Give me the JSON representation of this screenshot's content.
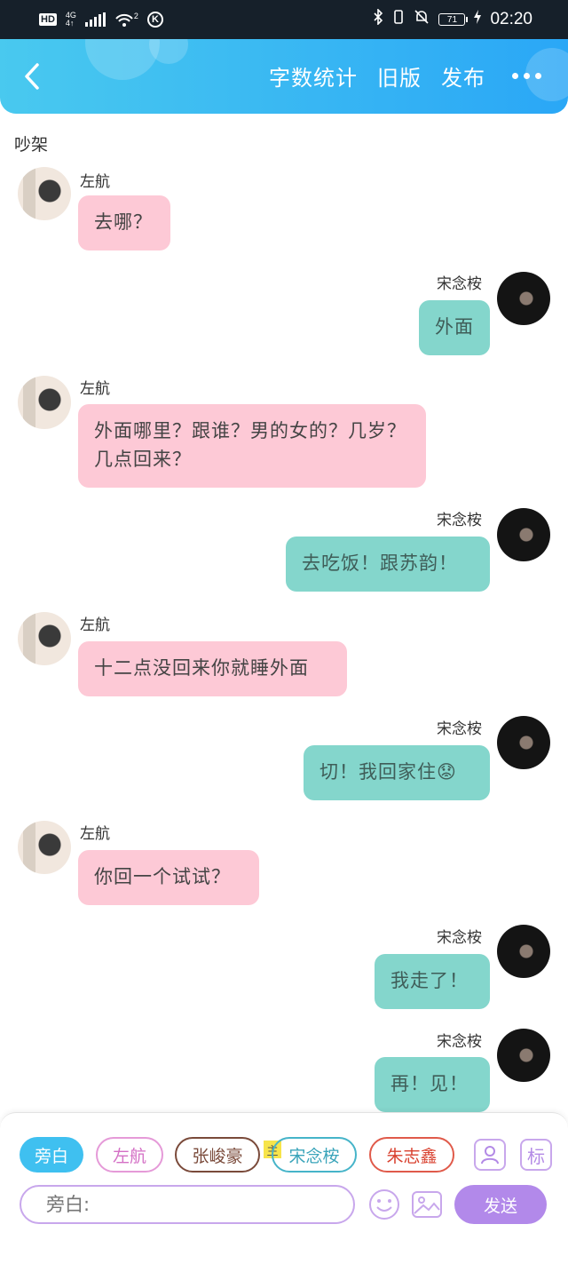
{
  "status_bar": {
    "left_badge": "HD",
    "network_top": "4G",
    "network_bottom": "4↑",
    "wifi_sub": "2",
    "k_label": "K",
    "battery": "71",
    "time": "02:20"
  },
  "header": {
    "actions": [
      "字数统计",
      "旧版",
      "发布"
    ]
  },
  "story_title": "吵架",
  "messages": [
    {
      "side": "left",
      "name": "左航",
      "text": "去哪？"
    },
    {
      "side": "right",
      "name": "宋念桉",
      "text": "外面"
    },
    {
      "side": "left",
      "name": "左航",
      "text": "外面哪里？跟谁？男的女的？几岁？几点回来？"
    },
    {
      "side": "right",
      "name": "宋念桉",
      "text": "去吃饭！跟苏韵！"
    },
    {
      "side": "left",
      "name": "左航",
      "text": "十二点没回来你就睡外面"
    },
    {
      "side": "right",
      "name": "宋念桉",
      "text": "切！我回家住😟"
    },
    {
      "side": "left",
      "name": "左航",
      "text": "你回一个试试？"
    },
    {
      "side": "right",
      "name": "宋念桉",
      "text": "我走了！"
    },
    {
      "side": "right",
      "name": "宋念桉",
      "text": "再！见！"
    }
  ],
  "bottom": {
    "roles": [
      "旁白",
      "左航",
      "张峻豪",
      "宋念桉",
      "朱志鑫"
    ],
    "main_tag": "主",
    "mark_icon_label": "标",
    "input_placeholder": "旁白:",
    "send_label": "发送"
  },
  "colors": {
    "header_start": "#49c9ef",
    "header_end": "#2aa7f6",
    "left_bubble": "#fdc9d6",
    "right_bubble": "#84d6cc",
    "accent_purple": "#b289ea"
  }
}
